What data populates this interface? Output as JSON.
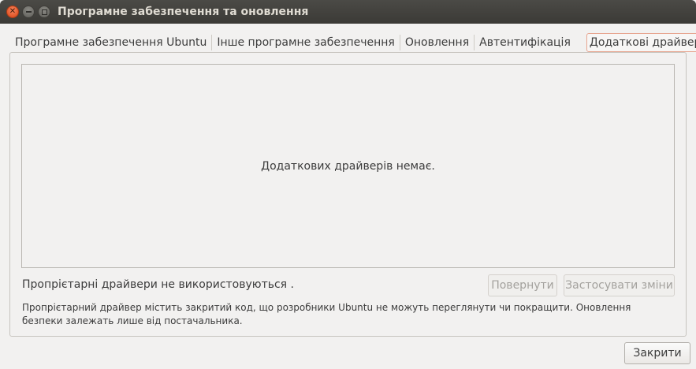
{
  "window": {
    "title": "Програмне забезпечення та оновлення",
    "controls": {
      "close_icon": "close-icon",
      "minimize_icon": "minimize-icon",
      "maximize_icon": "maximize-icon"
    }
  },
  "tabs": [
    {
      "label": "Програмне забезпечення Ubuntu",
      "active": false
    },
    {
      "label": "Інше програмне забезпечення",
      "active": false
    },
    {
      "label": "Оновлення",
      "active": false
    },
    {
      "label": "Автентифікація",
      "active": false
    },
    {
      "label": "Додаткові драйвери",
      "active": true
    }
  ],
  "drivers": {
    "empty_message": "Додаткових драйверів немає."
  },
  "status": {
    "text": "Пропрієтарні драйвери не використовуються ."
  },
  "buttons": {
    "revert": "Повернути",
    "apply": "Застосувати зміни",
    "close": "Закрити"
  },
  "info": {
    "text": "Пропрієтарний драйвер містить закритий код, що розробники Ubuntu не можуть переглянути чи покращити. Оновлення безпеки залежать лише від постачальника."
  },
  "colors": {
    "titlebar": "#3b3a36",
    "window_bg": "#f2f1f0",
    "active_tab_border": "#e7a590",
    "close_button": "#e3572a"
  }
}
